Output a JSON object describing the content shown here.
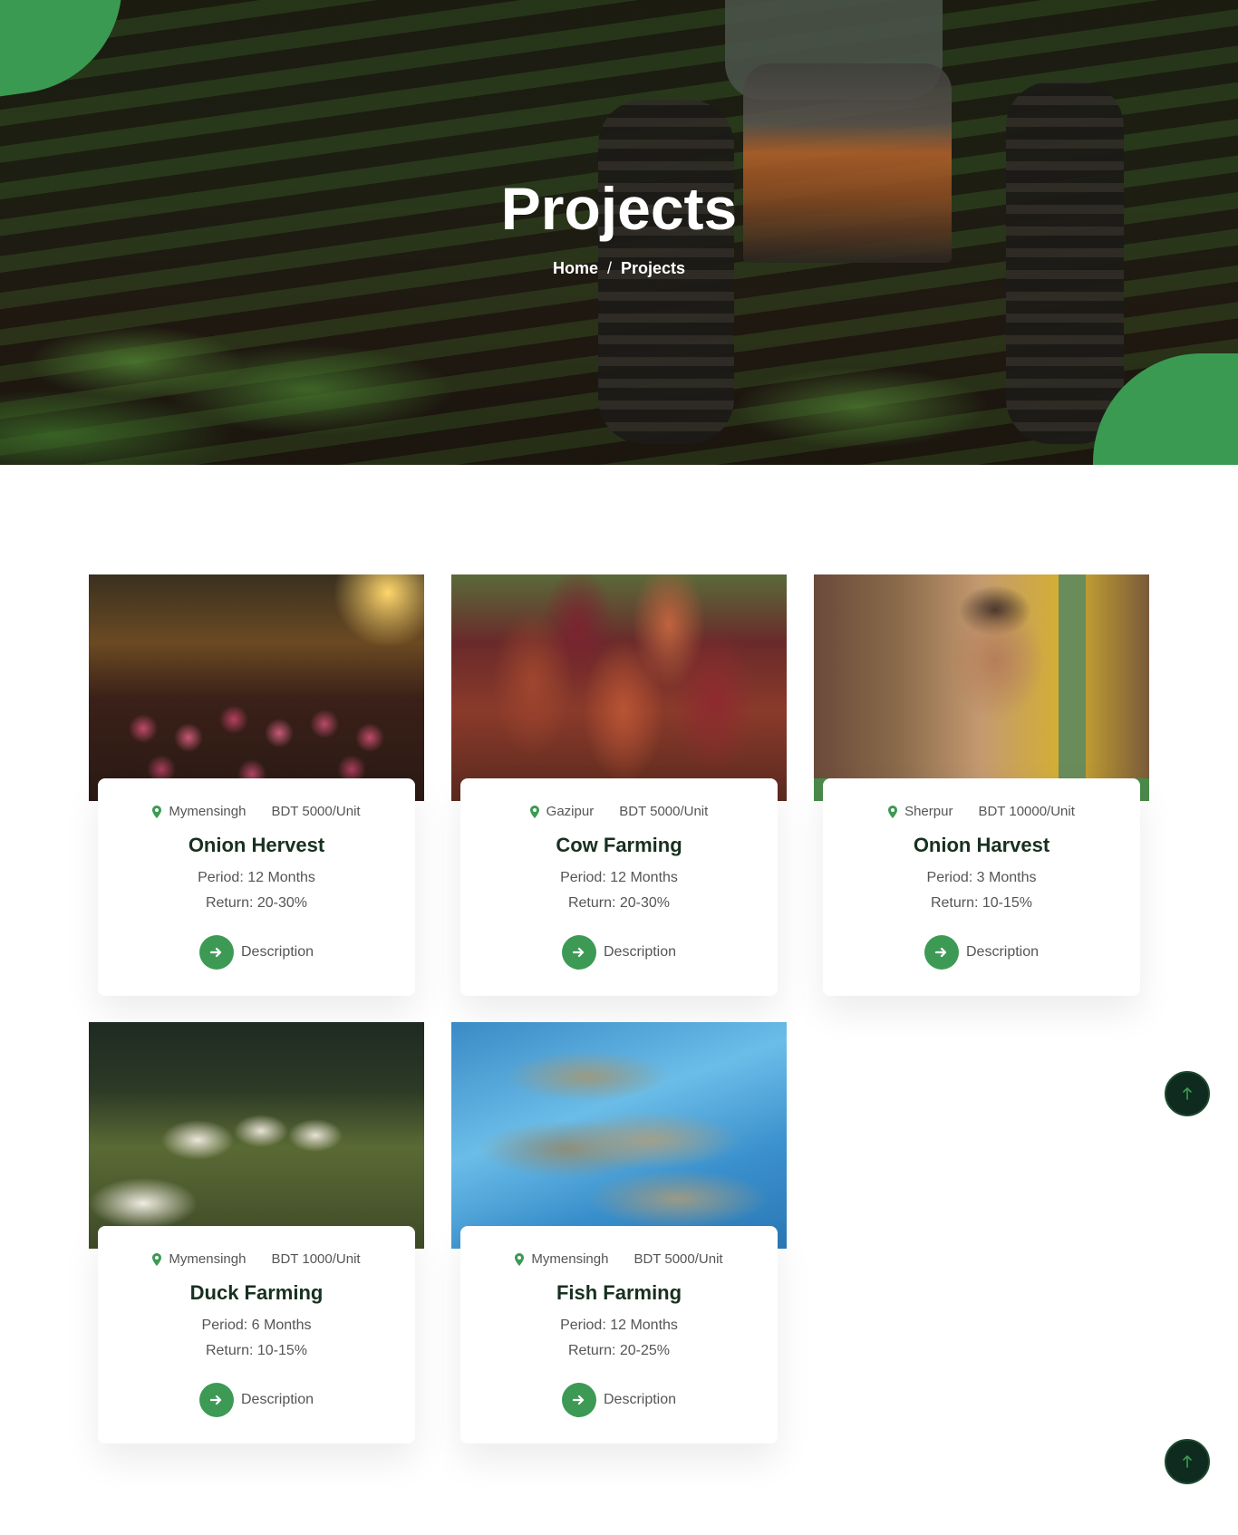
{
  "hero": {
    "title": "Projects",
    "breadcrumb": [
      {
        "label": "Home"
      },
      {
        "label": "Projects"
      }
    ],
    "separator": "/"
  },
  "colors": {
    "accent": "#3d9a55",
    "title_dark": "#17301f",
    "to_top_bg": "#0f2a1e"
  },
  "projects": [
    {
      "location": "Mymensingh",
      "price": "BDT 5000/Unit",
      "title": "Onion Hervest",
      "period": "Period: 12 Months",
      "return": "Return: 20-30%",
      "link": "Description"
    },
    {
      "location": "Gazipur",
      "price": "BDT 5000/Unit",
      "title": "Cow Farming",
      "period": "Period: 12 Months",
      "return": "Return: 20-30%",
      "link": "Description"
    },
    {
      "location": "Sherpur",
      "price": "BDT 10000/Unit",
      "title": "Onion Harvest",
      "period": "Period: 3 Months",
      "return": "Return: 10-15%",
      "link": "Description"
    },
    {
      "location": "Mymensingh",
      "price": "BDT 1000/Unit",
      "title": "Duck Farming",
      "period": "Period: 6 Months",
      "return": "Return: 10-15%",
      "link": "Description"
    },
    {
      "location": "Mymensingh",
      "price": "BDT 5000/Unit",
      "title": "Fish Farming",
      "period": "Period: 12 Months",
      "return": "Return: 20-25%",
      "link": "Description"
    }
  ],
  "icons": {
    "location": "map-pin-icon",
    "arrow": "arrow-right-icon",
    "to_top": "arrow-up-icon"
  }
}
